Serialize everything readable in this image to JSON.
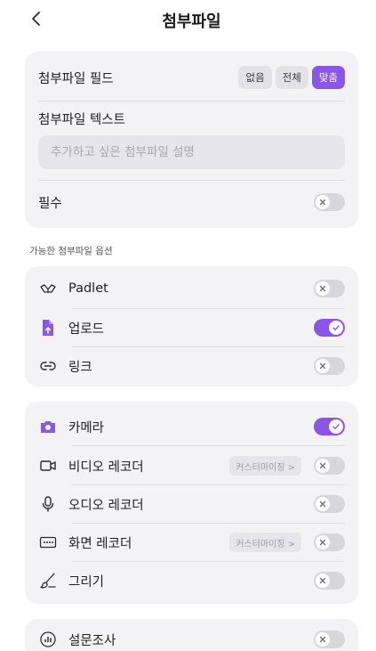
{
  "header": {
    "title": "첨부파일"
  },
  "settings": {
    "attachment_field_label": "첨부파일 필드",
    "segments": [
      "없음",
      "전체",
      "맞춤"
    ],
    "active_segment": "맞춤",
    "attachment_text_label": "첨부파일 텍스트",
    "attachment_text_placeholder": "추가하고 싶은 첨부파일 설명",
    "required_label": "필수",
    "required_on": false
  },
  "options_section": {
    "label": "가능한 첨부파일 옵션"
  },
  "group1": [
    {
      "label": "Padlet",
      "icon": "padlet-icon",
      "on": false
    },
    {
      "label": "업로드",
      "icon": "upload-file-icon",
      "on": true
    },
    {
      "label": "링크",
      "icon": "link-icon",
      "on": false
    }
  ],
  "group2": [
    {
      "label": "카메라",
      "icon": "camera-icon",
      "on": true
    },
    {
      "label": "비디오 레코더",
      "icon": "video-icon",
      "on": false,
      "chip": "커스터마이징 >"
    },
    {
      "label": "오디오 레코더",
      "icon": "microphone-icon",
      "on": false
    },
    {
      "label": "화면 레코더",
      "icon": "screen-record-icon",
      "on": false,
      "chip": "커스터마이징 >"
    },
    {
      "label": "그리기",
      "icon": "brush-icon",
      "on": false
    }
  ],
  "group3": [
    {
      "label": "설문조사",
      "icon": "poll-icon",
      "on": false
    }
  ],
  "colors": {
    "accent": "#8a55e8",
    "card": "#f3f3f5",
    "toggle_off": "#d6d6db"
  }
}
